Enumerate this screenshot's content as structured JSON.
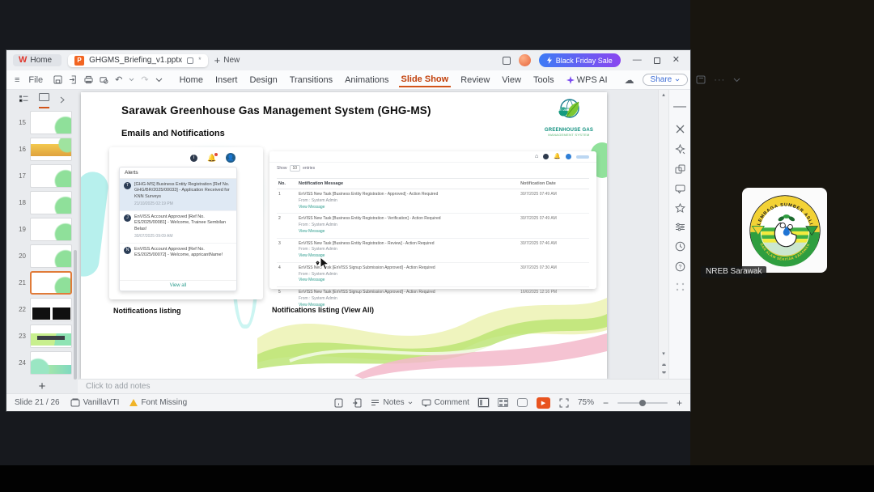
{
  "meeting": {
    "participant_label": "NREB Sarawak",
    "logo_top_text": "LEMBAGA SUMBER ASLI",
    "logo_bottom_text": "DAN ALAM SEKITAR SARAWAK"
  },
  "titlebar": {
    "home_tab": "Home",
    "doc_tab": "GHGMS_Briefing_v1.pptx",
    "unsaved_marker": "*",
    "new_tab": "New",
    "promo_label": "Black Friday Sale"
  },
  "menubar": {
    "file": "File",
    "items": [
      "Home",
      "Insert",
      "Design",
      "Transitions",
      "Animations",
      "Slide Show",
      "Review",
      "View",
      "Tools",
      "WPS AI"
    ],
    "share_label": "Share"
  },
  "slide_panel": {
    "numbers": [
      "15",
      "16",
      "17",
      "18",
      "19",
      "20",
      "21",
      "22",
      "23",
      "24"
    ],
    "selected": "21",
    "add_label": "+"
  },
  "slide": {
    "title": "Sarawak Greenhouse Gas Management System (GHG-MS)",
    "subtitle": "Emails and Notifications",
    "logo": {
      "badge": "NET 2050",
      "line1": "GREENHOUSE GAS",
      "line2": "MANAGEMENT SYSTEM"
    },
    "caption_left": "Notifications listing",
    "caption_right": "Notifications listing (View All)",
    "alerts": {
      "title": "Alerts",
      "view_all": "View all",
      "items": [
        {
          "avatar": "T",
          "text": "[GHG-MS] Business Entity Registration [Ref No. GHG/BR/2025/00033] - Application Received for KNN Surveys",
          "time": "21/10/2025 02:19 PM"
        },
        {
          "avatar": "J",
          "text": "EnVISS Account Approved [Ref No. ES/2025/00081] - Welcome, Trainee Sembilan Belas!",
          "time": "30/07/2025 09:09 AM"
        },
        {
          "avatar": "N",
          "text": "EnVISS Account Approved [Ref No. ES/2025/00072] - Welcome, appricantName!",
          "time": ""
        }
      ]
    },
    "portal": {
      "show": "Show",
      "page_size": "10",
      "entries": "entries",
      "headers": [
        "No.",
        "Notification Message",
        "Notification Date"
      ],
      "rows": [
        {
          "no": "1",
          "message": "EnVISS New Task [Business Entity Registration - Approved] - Action Required",
          "from": "From : System Admin",
          "link": "View Message",
          "date": "30/7/2025 07:49 AM"
        },
        {
          "no": "2",
          "message": "EnVISS New Task [Business Entity Registration - Verification] - Action Required",
          "from": "From : System Admin",
          "link": "View Message",
          "date": "30/7/2025 07:49 AM"
        },
        {
          "no": "3",
          "message": "EnVISS New Task [Business Entity Registration - Review] - Action Required",
          "from": "From : System Admin",
          "link": "View Message",
          "date": "30/7/2025 07:46 AM"
        },
        {
          "no": "4",
          "message": "EnVISS New Task [EnVISS Signup Submission Approved] - Action Required",
          "from": "From : System Admin",
          "link": "View Message",
          "date": "30/7/2025 07:30 AM"
        },
        {
          "no": "5",
          "message": "EnVISS New Task [EnVISS Signup Submission Approved] - Action Required",
          "from": "From : System Admin",
          "link": "View Message",
          "date": "16/6/2025 12:16 PM"
        }
      ]
    }
  },
  "notes_bar": {
    "placeholder": "Click to add notes"
  },
  "status_bar": {
    "slide_indicator": "Slide 21 / 26",
    "design_name": "VanillaVTI",
    "font_missing": "Font Missing",
    "notes": "Notes",
    "comment": "Comment",
    "zoom_level": "75%"
  }
}
